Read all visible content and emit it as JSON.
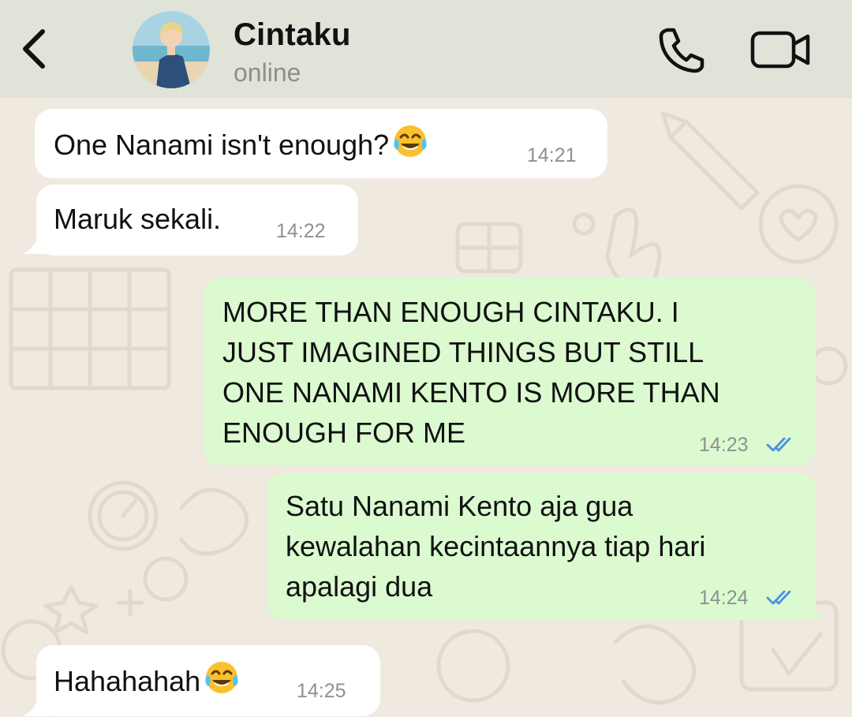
{
  "contact": {
    "name": "Cintaku",
    "status": "online"
  },
  "icons": {
    "back": "chevron-left-icon",
    "call": "phone-icon",
    "video": "video-camera-icon",
    "read": "double-check-icon",
    "emoji": "face-with-tears-of-joy-emoji"
  },
  "colors": {
    "header_bg": "#dfe3d8",
    "chat_bg": "#efe9df",
    "incoming_bubble": "#ffffff",
    "outgoing_bubble": "#dbfad0",
    "read_tick": "#4a90e2"
  },
  "messages": [
    {
      "direction": "incoming",
      "text": "One Nanami isn't enough?",
      "emoji": "😂",
      "time": "14:21"
    },
    {
      "direction": "incoming",
      "text": "Maruk sekali.",
      "time": "14:22"
    },
    {
      "direction": "outgoing",
      "lines": [
        "MORE THAN ENOUGH CINTAKU. I",
        "JUST IMAGINED THINGS BUT STILL",
        "ONE NANAMI KENTO IS MORE THAN",
        "ENOUGH FOR ME"
      ],
      "time": "14:23",
      "read": true
    },
    {
      "direction": "outgoing",
      "lines": [
        "Satu Nanami Kento aja gua",
        "kewalahan kecintaannya tiap hari",
        "apalagi dua"
      ],
      "time": "14:24",
      "read": true
    },
    {
      "direction": "incoming",
      "text": "Hahahahah",
      "emoji": "😂",
      "time": "14:25"
    }
  ]
}
